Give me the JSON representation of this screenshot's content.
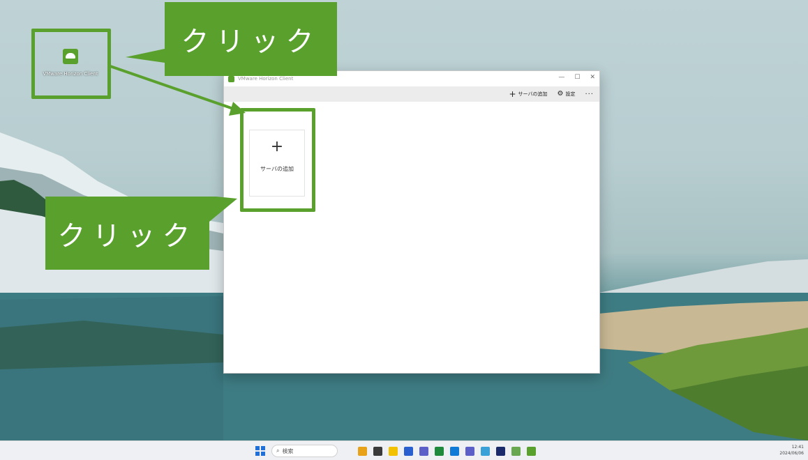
{
  "desktop": {
    "icon_label": "VMware Horizon Client"
  },
  "window": {
    "title": "VMware Horizon Client",
    "controls": {
      "minimize": "—",
      "maximize": "☐",
      "close": "✕"
    },
    "toolbar": {
      "add_server_label": "サーバの追加",
      "settings_label": "設定",
      "more_label": "···"
    },
    "card": {
      "plus": "+",
      "label": "サーバの追加"
    }
  },
  "annotations": {
    "callout_top": "クリック",
    "callout_left": "クリック",
    "color": "#5aa02c"
  },
  "taskbar": {
    "search_placeholder": "検索",
    "time": "12:41",
    "date": "2024/06/06",
    "apps": [
      "#e8a21a",
      "#3a3a3a",
      "#f2c100",
      "#2a5fd0",
      "#5b5fc7",
      "#1f8a3c",
      "#0f7bd6",
      "#5b5fc7",
      "#3aa1d8",
      "#1b2a6b",
      "#6aa84f",
      "#5aa02c"
    ]
  }
}
